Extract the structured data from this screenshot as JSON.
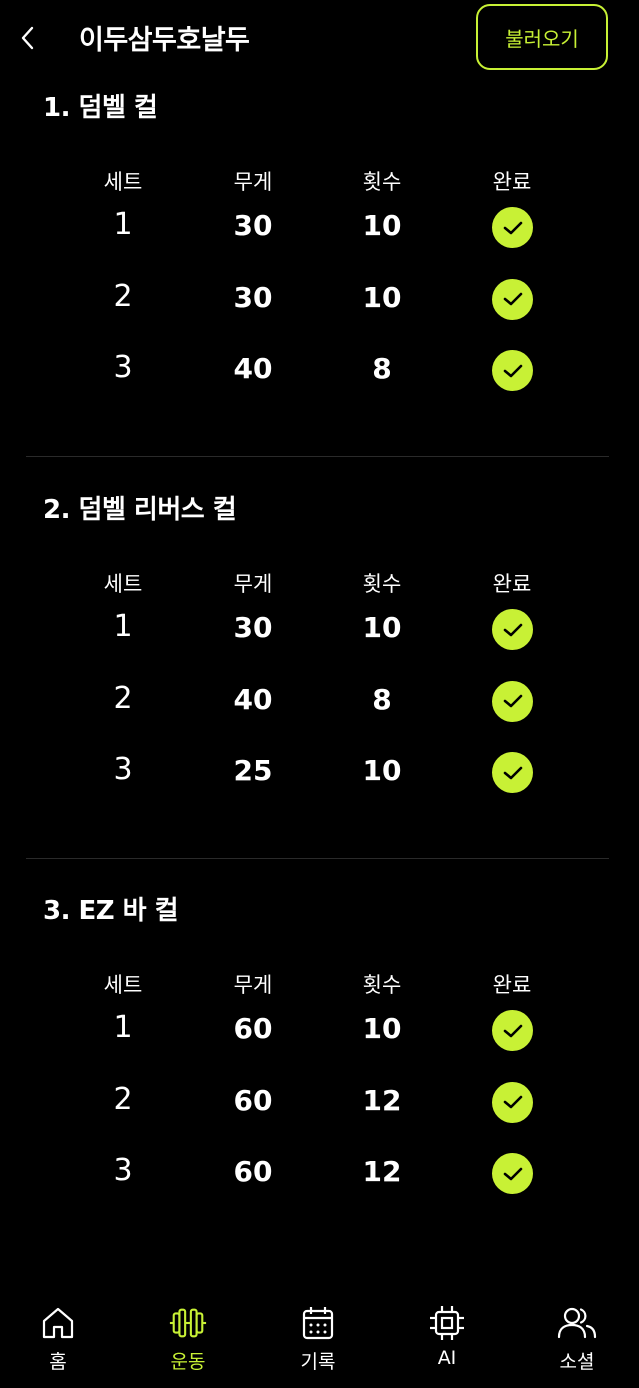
{
  "header": {
    "title": "이두삼두호날두",
    "load_label": "불러오기"
  },
  "columns": [
    "세트",
    "무게",
    "횟수",
    "완료"
  ],
  "exercises": [
    {
      "name": "1. 덤벨 컬",
      "sets": [
        {
          "set": "1",
          "weight": "30",
          "reps": "10",
          "done": true
        },
        {
          "set": "2",
          "weight": "30",
          "reps": "10",
          "done": true
        },
        {
          "set": "3",
          "weight": "40",
          "reps": "8",
          "done": true
        }
      ]
    },
    {
      "name": "2. 덤벨 리버스 컬",
      "sets": [
        {
          "set": "1",
          "weight": "30",
          "reps": "10",
          "done": true
        },
        {
          "set": "2",
          "weight": "40",
          "reps": "8",
          "done": true
        },
        {
          "set": "3",
          "weight": "25",
          "reps": "10",
          "done": true
        }
      ]
    },
    {
      "name": "3. EZ 바 컬",
      "sets": [
        {
          "set": "1",
          "weight": "60",
          "reps": "10",
          "done": true
        },
        {
          "set": "2",
          "weight": "60",
          "reps": "12",
          "done": true
        },
        {
          "set": "3",
          "weight": "60",
          "reps": "12",
          "done": true
        }
      ]
    }
  ],
  "nav": {
    "items": [
      {
        "label": "홈",
        "icon": "home-icon"
      },
      {
        "label": "운동",
        "icon": "dumbbell-icon",
        "active": true
      },
      {
        "label": "기록",
        "icon": "calendar-icon"
      },
      {
        "label": "AI",
        "icon": "chip-icon"
      },
      {
        "label": "소셜",
        "icon": "users-icon"
      }
    ]
  },
  "colors": {
    "accent": "#c8f135",
    "background": "#000000",
    "text": "#ffffff"
  }
}
